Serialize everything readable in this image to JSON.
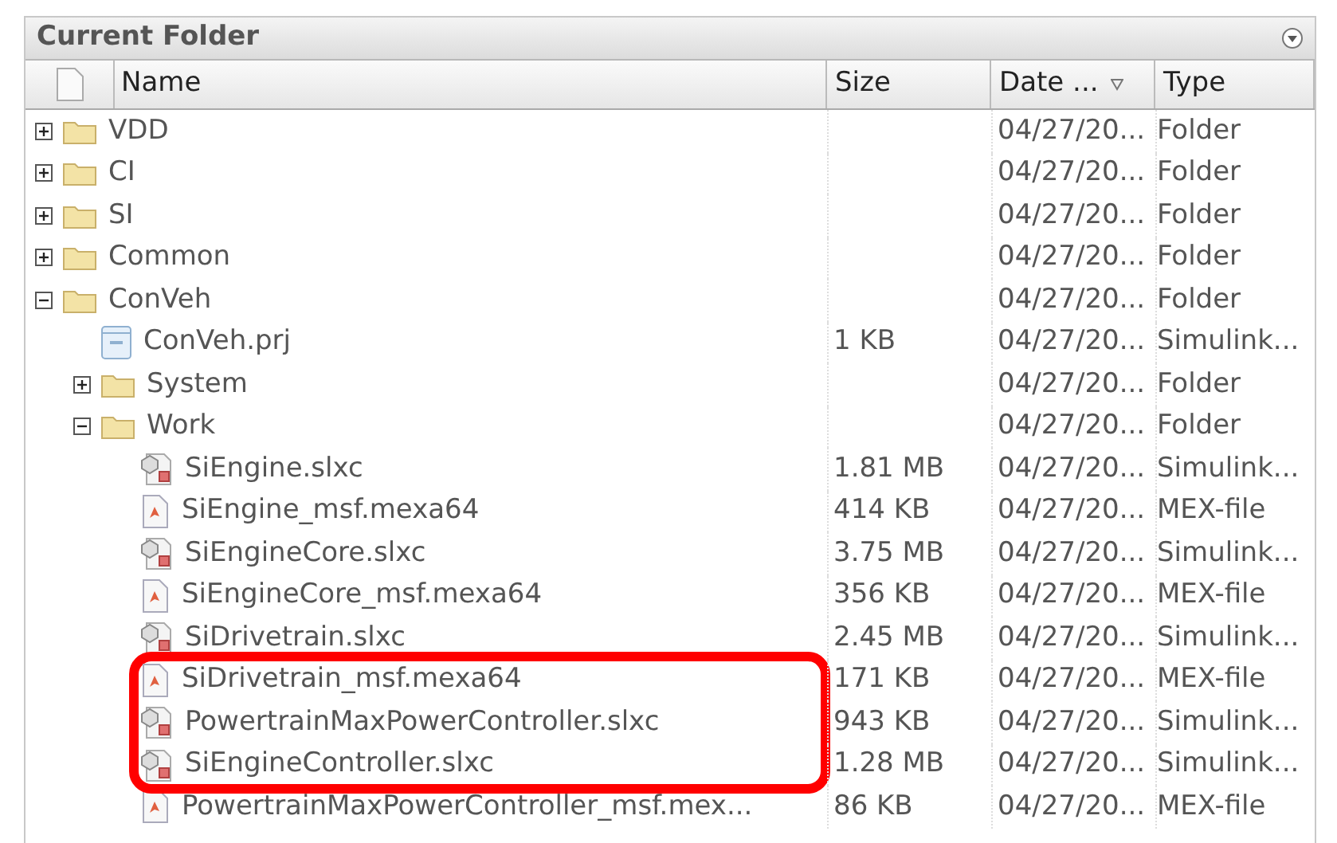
{
  "panel": {
    "title": "Current Folder"
  },
  "columns": [
    {
      "label": "Name"
    },
    {
      "label": "Size"
    },
    {
      "label": "Date ...",
      "sorted": true
    },
    {
      "label": "Type"
    }
  ],
  "tree": [
    {
      "kind": "folder",
      "name": "VDD",
      "date": "04/27/20...",
      "type": "Folder",
      "expanded": false,
      "highlighted": false
    },
    {
      "kind": "folder",
      "name": "CI",
      "date": "04/27/20...",
      "type": "Folder",
      "expanded": false,
      "highlighted": false
    },
    {
      "kind": "folder",
      "name": "SI",
      "date": "04/27/20...",
      "type": "Folder",
      "expanded": false,
      "highlighted": false
    },
    {
      "kind": "folder",
      "name": "Common",
      "date": "04/27/20...",
      "type": "Folder",
      "expanded": false,
      "highlighted": false
    },
    {
      "kind": "folder",
      "name": "ConVeh",
      "date": "04/27/20...",
      "type": "Folder",
      "expanded": true,
      "highlighted": false,
      "children": [
        {
          "kind": "project",
          "name": "ConVeh.prj",
          "size": "1 KB",
          "date": "04/27/20...",
          "type": "Simulink...",
          "highlighted": false
        },
        {
          "kind": "folder",
          "name": "System",
          "date": "04/27/20...",
          "type": "Folder",
          "expanded": false,
          "highlighted": false
        },
        {
          "kind": "folder",
          "name": "Work",
          "date": "04/27/20...",
          "type": "Folder",
          "expanded": true,
          "highlighted": false,
          "children": [
            {
              "kind": "model",
              "name": "SiEngine.slxc",
              "size": "1.81 MB",
              "date": "04/27/20...",
              "type": "Simulink...",
              "highlighted": false
            },
            {
              "kind": "mex",
              "name": "SiEngine_msf.mexa64",
              "size": "414 KB",
              "date": "04/27/20...",
              "type": "MEX-file",
              "highlighted": false
            },
            {
              "kind": "model",
              "name": "SiEngineCore.slxc",
              "size": "3.75 MB",
              "date": "04/27/20...",
              "type": "Simulink...",
              "highlighted": false
            },
            {
              "kind": "mex",
              "name": "SiEngineCore_msf.mexa64",
              "size": "356 KB",
              "date": "04/27/20...",
              "type": "MEX-file",
              "highlighted": false
            },
            {
              "kind": "model",
              "name": "SiDrivetrain.slxc",
              "size": "2.45 MB",
              "date": "04/27/20...",
              "type": "Simulink...",
              "highlighted": false
            },
            {
              "kind": "mex",
              "name": "SiDrivetrain_msf.mexa64",
              "size": "171 KB",
              "date": "04/27/20...",
              "type": "MEX-file",
              "highlighted": true
            },
            {
              "kind": "model",
              "name": "PowertrainMaxPowerController.slxc",
              "size": "943 KB",
              "date": "04/27/20...",
              "type": "Simulink...",
              "highlighted": true
            },
            {
              "kind": "model",
              "name": "SiEngineController.slxc",
              "size": "1.28 MB",
              "date": "04/27/20...",
              "type": "Simulink...",
              "highlighted": true
            },
            {
              "kind": "mex",
              "name": "PowertrainMaxPowerController_msf.mex...",
              "size": "86 KB",
              "date": "04/27/20...",
              "type": "MEX-file",
              "highlighted": false
            }
          ]
        }
      ]
    }
  ]
}
